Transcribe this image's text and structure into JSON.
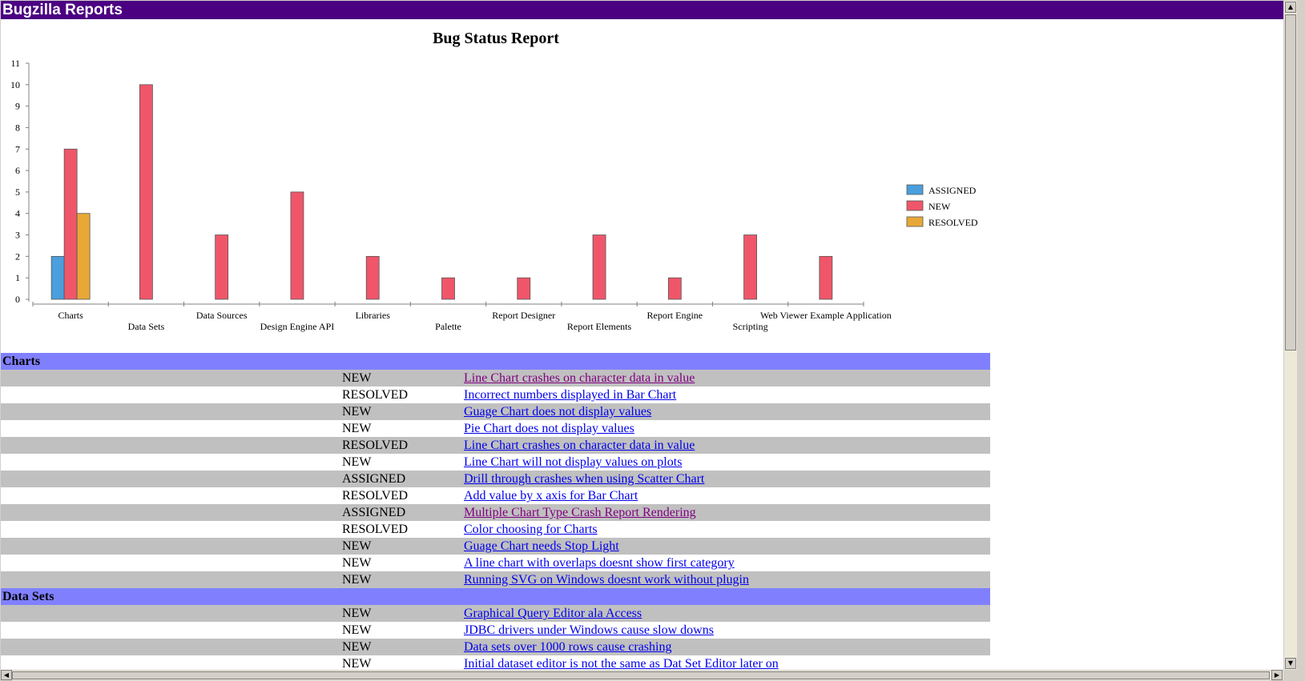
{
  "window": {
    "title": "Bugzilla Reports"
  },
  "colors": {
    "titlebar": "#4b0082",
    "group_header": "#8080ff",
    "row_alt": "#c0c0c0",
    "link": "#0000ee",
    "visited_link": "#800080"
  },
  "chart_data": {
    "type": "bar",
    "title": "Bug Status Report",
    "xlabel": "",
    "ylabel": "",
    "ylim": [
      0,
      11
    ],
    "yticks": [
      0,
      1,
      2,
      3,
      4,
      5,
      6,
      7,
      8,
      9,
      10,
      11
    ],
    "grid": false,
    "legend_position": "right",
    "categories": [
      "Charts",
      "Data Sets",
      "Data Sources",
      "Design Engine API",
      "Libraries",
      "Palette",
      "Report Designer",
      "Report Elements",
      "Report Engine",
      "Scripting",
      "Web Viewer Example Application"
    ],
    "series": [
      {
        "name": "ASSIGNED",
        "color": "#4a9fdc",
        "values": [
          2,
          0,
          0,
          0,
          0,
          0,
          0,
          0,
          0,
          0,
          0
        ]
      },
      {
        "name": "NEW",
        "color": "#f0566a",
        "values": [
          7,
          10,
          3,
          5,
          2,
          1,
          1,
          3,
          1,
          3,
          2
        ]
      },
      {
        "name": "RESOLVED",
        "color": "#e8a838",
        "values": [
          4,
          0,
          0,
          0,
          0,
          0,
          0,
          0,
          0,
          0,
          0
        ]
      }
    ]
  },
  "report": {
    "groups": [
      {
        "name": "Charts",
        "rows": [
          {
            "status": "NEW",
            "title": "Line Chart crashes on character data in value",
            "visited": true
          },
          {
            "status": "RESOLVED",
            "title": "Incorrect numbers displayed in Bar Chart",
            "visited": false
          },
          {
            "status": "NEW",
            "title": "Guage Chart does not display values",
            "visited": false
          },
          {
            "status": "NEW",
            "title": "Pie Chart does not display values",
            "visited": false
          },
          {
            "status": "RESOLVED",
            "title": "Line Chart crashes on character data in value",
            "visited": false
          },
          {
            "status": "NEW",
            "title": "Line Chart will not display values on plots",
            "visited": false
          },
          {
            "status": "ASSIGNED",
            "title": "Drill through crashes when using Scatter Chart",
            "visited": false
          },
          {
            "status": "RESOLVED",
            "title": "Add value by x axis for Bar Chart",
            "visited": false
          },
          {
            "status": "ASSIGNED",
            "title": "Multiple Chart Type Crash Report Rendering",
            "visited": true
          },
          {
            "status": "RESOLVED",
            "title": "Color choosing for Charts",
            "visited": false
          },
          {
            "status": "NEW",
            "title": "Guage Chart needs Stop Light",
            "visited": false
          },
          {
            "status": "NEW",
            "title": "A line chart with overlaps doesnt show first category",
            "visited": false
          },
          {
            "status": "NEW",
            "title": "Running SVG on Windows doesnt work without plugin",
            "visited": false
          }
        ]
      },
      {
        "name": "Data Sets",
        "rows": [
          {
            "status": "NEW",
            "title": "Graphical Query Editor ala  Access",
            "visited": false
          },
          {
            "status": "NEW",
            "title": "JDBC drivers under Windows cause slow downs",
            "visited": false
          },
          {
            "status": "NEW",
            "title": "Data sets over 1000 rows cause crashing",
            "visited": false
          },
          {
            "status": "NEW",
            "title": "Initial dataset editor is not the same as Dat Set Editor later on",
            "visited": false
          }
        ]
      }
    ]
  },
  "icons": {
    "scroll_up": "triangle-up",
    "scroll_down": "triangle-down",
    "scroll_left": "triangle-left",
    "scroll_right": "triangle-right"
  }
}
